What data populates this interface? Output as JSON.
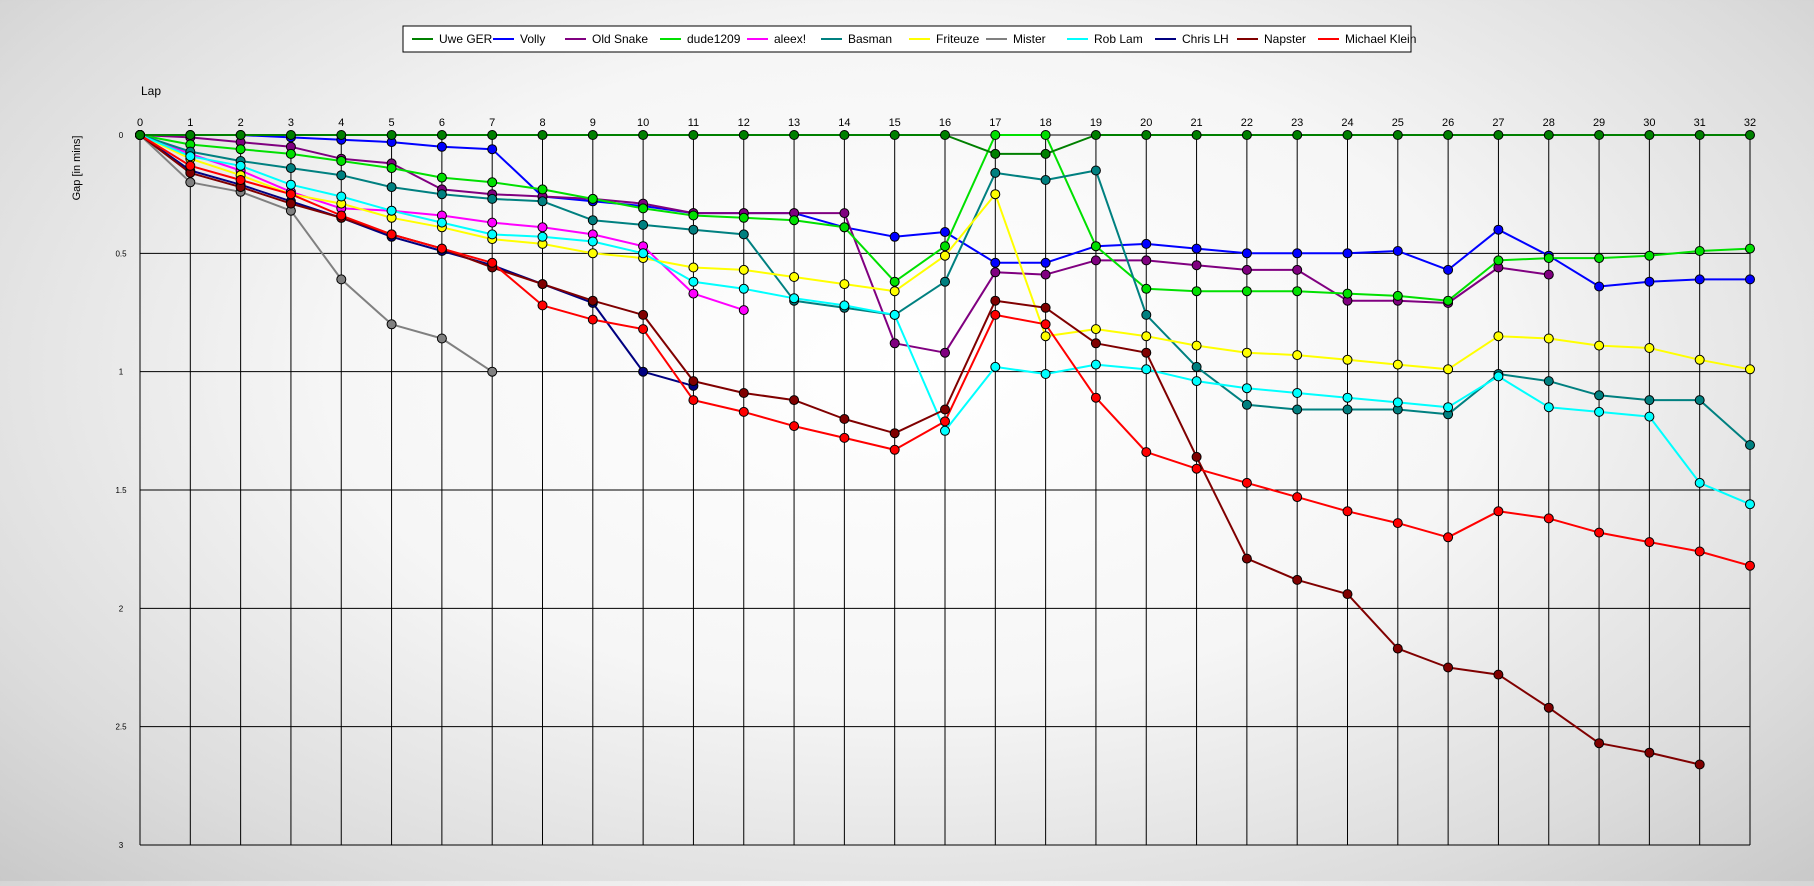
{
  "chart_data": {
    "type": "line",
    "xlabel": "Lap",
    "ylabel": "Gap [in mins]",
    "x": [
      0,
      1,
      2,
      3,
      4,
      5,
      6,
      7,
      8,
      9,
      10,
      11,
      12,
      13,
      14,
      15,
      16,
      17,
      18,
      19,
      20,
      21,
      22,
      23,
      24,
      25,
      26,
      27,
      28,
      29,
      30,
      31,
      32
    ],
    "xlim": [
      0,
      32
    ],
    "ylim": [
      0,
      3
    ],
    "y_inverted": true,
    "y_ticks": [
      "0",
      "0.5",
      "1",
      "1.5",
      "2",
      "2.5",
      "3"
    ],
    "grid": true,
    "legend_position": "top-center",
    "series": [
      {
        "name": "Uwe GER",
        "color": "#008000",
        "values": [
          0,
          0,
          0,
          0,
          0,
          0,
          0,
          0,
          0,
          0,
          0,
          0,
          0,
          0,
          0,
          0,
          0,
          0.08,
          0.08,
          0,
          0,
          0,
          0,
          0,
          0,
          0,
          0,
          0,
          0,
          0,
          0,
          0,
          0
        ]
      },
      {
        "name": "Volly",
        "color": "#0000ff",
        "values": [
          0,
          0,
          0,
          0.01,
          0.02,
          0.03,
          0.05,
          0.06,
          0.26,
          0.28,
          0.3,
          0.33,
          0.33,
          0.33,
          0.39,
          0.43,
          0.41,
          0.54,
          0.54,
          0.47,
          0.46,
          0.48,
          0.5,
          0.5,
          0.5,
          0.49,
          0.57,
          0.4,
          0.51,
          0.64,
          0.62,
          0.61,
          0.61
        ]
      },
      {
        "name": "Old Snake",
        "color": "#800080",
        "values": [
          0,
          0.01,
          0.03,
          0.05,
          0.1,
          0.12,
          0.23,
          0.25,
          0.26,
          0.27,
          0.29,
          0.33,
          0.33,
          0.33,
          0.33,
          0.88,
          0.92,
          0.58,
          0.59,
          0.53,
          0.53,
          0.55,
          0.57,
          0.57,
          0.7,
          0.7,
          0.71,
          0.56,
          0.59,
          null,
          null,
          null,
          null
        ]
      },
      {
        "name": "dude1209",
        "color": "#00e000",
        "values": [
          0,
          0.04,
          0.06,
          0.08,
          0.11,
          0.14,
          0.18,
          0.2,
          0.23,
          0.27,
          0.31,
          0.34,
          0.35,
          0.36,
          0.39,
          0.62,
          0.47,
          0,
          0,
          0.47,
          0.65,
          0.66,
          0.66,
          0.66,
          0.67,
          0.68,
          0.7,
          0.53,
          0.52,
          0.52,
          0.51,
          0.49,
          0.48
        ]
      },
      {
        "name": "aleex!",
        "color": "#ff00ff",
        "values": [
          0,
          0.08,
          0.15,
          0.24,
          0.31,
          0.32,
          0.34,
          0.37,
          0.39,
          0.42,
          0.47,
          0.67,
          0.74,
          null,
          null,
          null,
          null,
          null,
          null,
          null,
          null,
          null,
          null,
          null,
          null,
          null,
          null,
          null,
          null,
          null,
          null,
          null,
          null
        ]
      },
      {
        "name": "Basman",
        "color": "#008080",
        "values": [
          0,
          0.07,
          0.11,
          0.14,
          0.17,
          0.22,
          0.25,
          0.27,
          0.28,
          0.36,
          0.38,
          0.4,
          0.42,
          0.7,
          0.73,
          0.76,
          0.62,
          0.16,
          0.19,
          0.15,
          0.76,
          0.98,
          1.14,
          1.16,
          1.16,
          1.16,
          1.18,
          1.01,
          1.04,
          1.1,
          1.12,
          1.12,
          1.31
        ]
      },
      {
        "name": "Friteuze",
        "color": "#ffff00",
        "values": [
          0,
          0.1,
          0.17,
          0.25,
          0.29,
          0.35,
          0.39,
          0.44,
          0.46,
          0.5,
          0.52,
          0.56,
          0.57,
          0.6,
          0.63,
          0.66,
          0.51,
          0.25,
          0.85,
          0.82,
          0.85,
          0.89,
          0.92,
          0.93,
          0.95,
          0.97,
          0.99,
          0.85,
          0.86,
          0.89,
          0.9,
          0.95,
          0.99
        ]
      },
      {
        "name": "Mister",
        "color": "#808080",
        "values": [
          0,
          0.2,
          0.24,
          0.32,
          0.61,
          0.8,
          0.86,
          1,
          null,
          null,
          null,
          null,
          null,
          null,
          null,
          null,
          null,
          null,
          null,
          null,
          null,
          null,
          null,
          null,
          null,
          null,
          null,
          null,
          null,
          null,
          null,
          null,
          null
        ]
      },
      {
        "name": "Rob Lam",
        "color": "#00ffff",
        "values": [
          0,
          0.09,
          0.13,
          0.21,
          0.26,
          0.32,
          0.37,
          0.42,
          0.43,
          0.45,
          0.5,
          0.62,
          0.65,
          0.69,
          0.72,
          0.76,
          1.25,
          0.98,
          1.01,
          0.97,
          0.99,
          1.04,
          1.07,
          1.09,
          1.11,
          1.13,
          1.15,
          1.02,
          1.15,
          1.17,
          1.19,
          1.47,
          1.56
        ]
      },
      {
        "name": "Chris LH",
        "color": "#000080",
        "values": [
          0,
          0.15,
          0.21,
          0.28,
          0.35,
          0.43,
          0.49,
          0.55,
          0.63,
          0.71,
          1,
          1.06,
          null,
          null,
          null,
          null,
          null,
          null,
          null,
          null,
          null,
          null,
          null,
          null,
          null,
          null,
          null,
          null,
          null,
          null,
          null,
          null,
          null
        ]
      },
      {
        "name": "Napster",
        "color": "#800000",
        "values": [
          0,
          0.16,
          0.22,
          0.29,
          0.35,
          0.42,
          0.48,
          0.56,
          0.63,
          0.7,
          0.76,
          1.04,
          1.09,
          1.12,
          1.2,
          1.26,
          1.16,
          0.7,
          0.73,
          0.88,
          0.92,
          1.36,
          1.79,
          1.88,
          1.94,
          2.17,
          2.25,
          2.28,
          2.42,
          2.57,
          2.61,
          2.66,
          null
        ]
      },
      {
        "name": "Michael Klein",
        "color": "#ff0000",
        "values": [
          0,
          0.13,
          0.19,
          0.25,
          0.34,
          0.42,
          0.48,
          0.54,
          0.72,
          0.78,
          0.82,
          1.12,
          1.17,
          1.23,
          1.28,
          1.33,
          1.21,
          0.76,
          0.8,
          1.11,
          1.34,
          1.41,
          1.47,
          1.53,
          1.59,
          1.64,
          1.7,
          1.59,
          1.62,
          1.68,
          1.72,
          1.76,
          1.82
        ]
      }
    ]
  }
}
